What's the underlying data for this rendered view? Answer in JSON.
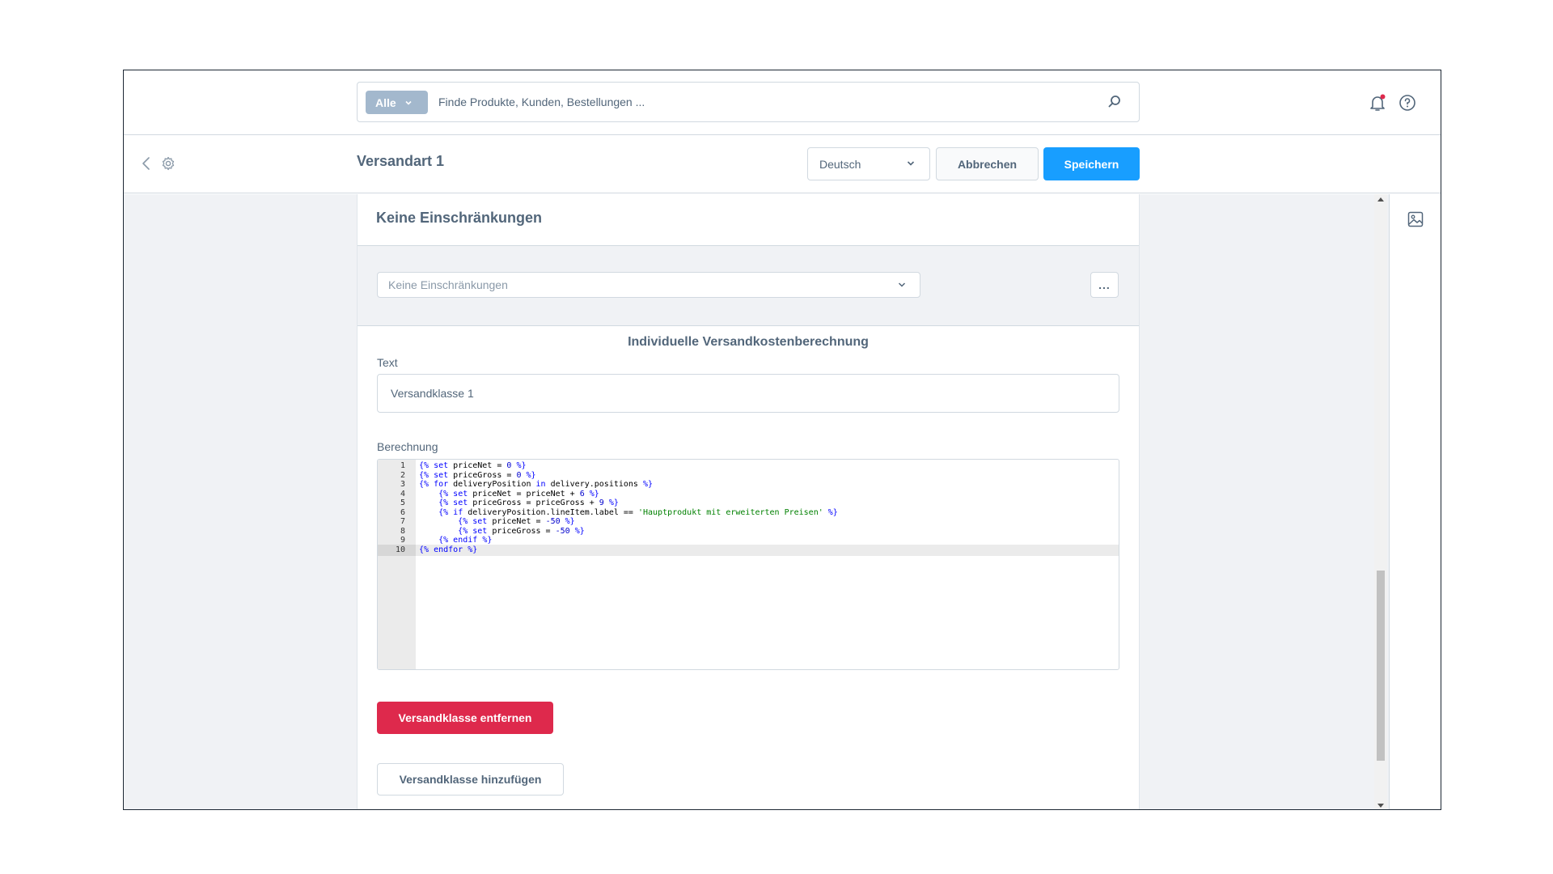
{
  "search": {
    "type_label": "Alle",
    "placeholder": "Finde Produkte, Kunden, Bestellungen ..."
  },
  "header": {
    "page_title": "Versandart 1",
    "language": "Deutsch",
    "cancel_label": "Abbrechen",
    "save_label": "Speichern"
  },
  "card": {
    "title": "Keine Einschränkungen",
    "rule_select_placeholder": "Keine Einschränkungen",
    "more_label": "...",
    "section_title": "Individuelle Versandkostenberechnung",
    "text_label": "Text",
    "text_value": "Versandklasse 1",
    "calc_label": "Berechnung",
    "remove_label": "Versandklasse entfernen",
    "add_label": "Versandklasse hinzufügen"
  },
  "code": {
    "active_line": 10,
    "lines": [
      "{% set priceNet = 0 %}",
      "{% set priceGross = 0 %}",
      "{% for deliveryPosition in delivery.positions %}",
      "    {% set priceNet = priceNet + 6 %}",
      "    {% set priceGross = priceGross + 9 %}",
      "    {% if deliveryPosition.lineItem.label == 'Hauptprodukt mit erweiterten Preisen' %}",
      "        {% set priceNet = -50 %}",
      "        {% set priceGross = -50 %}",
      "    {% endif %}",
      "{% endfor %}"
    ]
  },
  "colors": {
    "primary": "#189eff",
    "danger": "#de294c",
    "text": "#52667a",
    "border": "#d1d9e0"
  }
}
